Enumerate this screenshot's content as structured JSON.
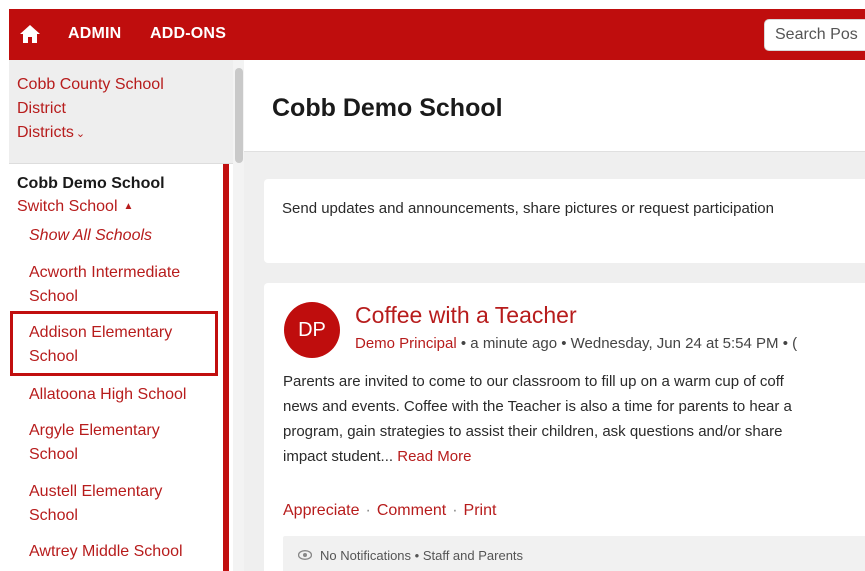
{
  "topbar": {
    "home_icon": "home-icon",
    "admin_label": "ADMIN",
    "addons_label": "ADD-ONS",
    "search_placeholder": "Search Pos"
  },
  "sidebar": {
    "district_name": "Cobb County School District",
    "districts_link": "Districts",
    "school_name": "Cobb Demo School",
    "switch_school": "Switch School",
    "schools": [
      "Show All Schools",
      "Acworth Intermediate School",
      "Addison Elementary School",
      "Allatoona High School",
      "Argyle Elementary School",
      "Austell Elementary School",
      "Awtrey Middle School"
    ]
  },
  "main": {
    "page_title": "Cobb Demo School",
    "compose_prompt": "Send updates and announcements, share pictures or request participation",
    "post": {
      "avatar_initials": "DP",
      "title": "Coffee with a Teacher",
      "author": "Demo Principal",
      "meta": " • a minute ago • Wednesday, Jun 24 at 5:54 PM • (",
      "body_lines": [
        "Parents are invited to come to our classroom to fill up on a warm cup of coff",
        "news and events. Coffee with the Teacher is also a time for parents to hear a",
        "program, gain strategies to assist their children, ask questions and/or share",
        "impact student... "
      ],
      "read_more": "Read More",
      "actions": {
        "appreciate": "Appreciate",
        "comment": "Comment",
        "print": "Print",
        "separator": "·"
      },
      "notification": "No Notifications • Staff and Parents"
    }
  },
  "colors": {
    "brand_red": "#bf0d0d",
    "link_red": "#b71c1c",
    "background_gray": "#efefef"
  }
}
